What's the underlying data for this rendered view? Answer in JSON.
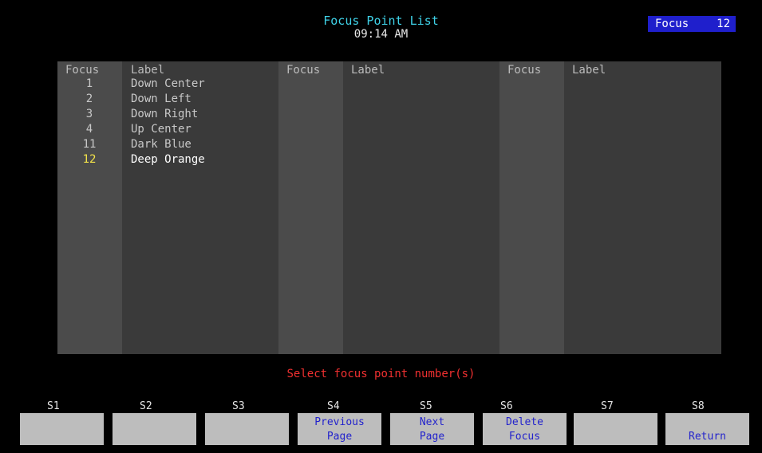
{
  "header": {
    "title": "Focus Point List",
    "time": "09:14 AM"
  },
  "mode_badge": {
    "label": "Focus",
    "value": "12"
  },
  "columns": [
    {
      "num_header": "Focus",
      "label_header": "Label"
    },
    {
      "num_header": "Focus",
      "label_header": "Label"
    },
    {
      "num_header": "Focus",
      "label_header": "Label"
    }
  ],
  "focus_points": [
    {
      "num": "1",
      "label": "Down Center",
      "selected": false
    },
    {
      "num": "2",
      "label": "Down Left",
      "selected": false
    },
    {
      "num": "3",
      "label": "Down Right",
      "selected": false
    },
    {
      "num": "4",
      "label": "Up Center",
      "selected": false
    },
    {
      "num": "11",
      "label": "Dark Blue",
      "selected": false
    },
    {
      "num": "12",
      "label": "Deep Orange",
      "selected": true
    }
  ],
  "prompt": "Select focus point number(s)",
  "softkeys": [
    {
      "name": "S1",
      "line1": "",
      "line2": ""
    },
    {
      "name": "S2",
      "line1": "",
      "line2": ""
    },
    {
      "name": "S3",
      "line1": "",
      "line2": ""
    },
    {
      "name": "S4",
      "line1": "Previous",
      "line2": "Page"
    },
    {
      "name": "S5",
      "line1": "Next",
      "line2": "Page"
    },
    {
      "name": "S6",
      "line1": "Delete",
      "line2": "Focus"
    },
    {
      "name": "S7",
      "line1": "",
      "line2": ""
    },
    {
      "name": "S8",
      "line1": "",
      "line2": "Return"
    }
  ]
}
